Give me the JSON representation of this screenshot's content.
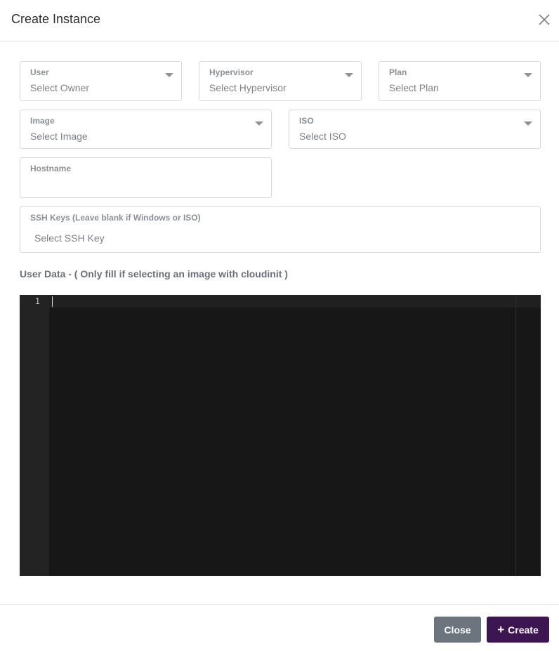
{
  "dialog": {
    "title": "Create Instance"
  },
  "form": {
    "user": {
      "label": "User",
      "placeholder": "Select Owner"
    },
    "hypervisor": {
      "label": "Hypervisor",
      "placeholder": "Select Hypervisor"
    },
    "plan": {
      "label": "Plan",
      "placeholder": "Select Plan"
    },
    "image": {
      "label": "Image",
      "placeholder": "Select Image"
    },
    "iso": {
      "label": "ISO",
      "placeholder": "Select ISO"
    },
    "hostname": {
      "label": "Hostname",
      "value": ""
    },
    "ssh_keys": {
      "label": "SSH Keys (Leave blank if Windows or ISO)",
      "placeholder": "Select SSH Key"
    },
    "user_data": {
      "label": "User Data - ( Only fill if selecting an image with cloudinit )"
    }
  },
  "editor": {
    "line_numbers": [
      "1"
    ]
  },
  "footer": {
    "close_label": "Close",
    "create_icon": "+",
    "create_label": "Create"
  },
  "colors": {
    "primary": "#3c1551",
    "secondary": "#6c757d",
    "editor_bg": "#171717"
  },
  "icons": {
    "close": "close-icon",
    "dropdown": "chevron-down-icon"
  }
}
